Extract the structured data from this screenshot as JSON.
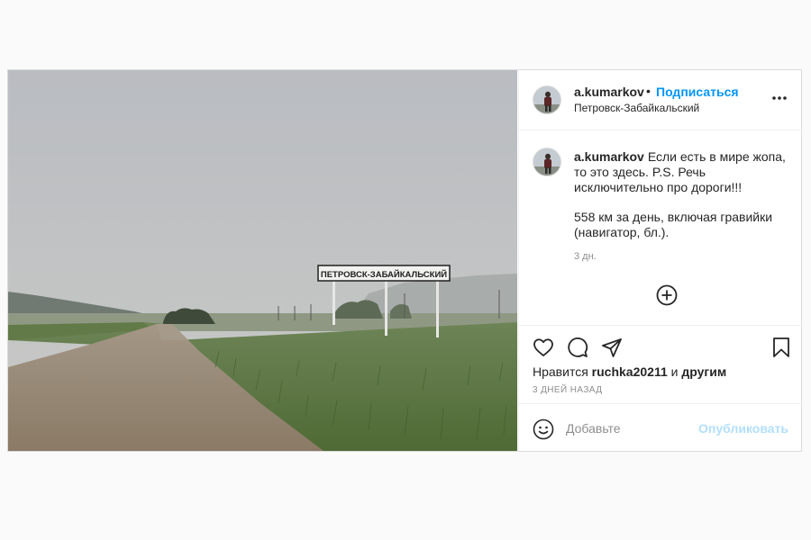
{
  "post": {
    "username": "a.kumarkov",
    "separator": "•",
    "follow_label": "Подписаться",
    "location": "Петровск-Забайкальский",
    "caption_line1": "Если есть в мире жопа, то это здесь. P.S. Речь исключительно про дороги!!!",
    "caption_line2": "558 км за день, включая гравийки (навигатор, бл.).",
    "time_ago": "3 дн.",
    "likes_prefix": "Нравится",
    "likes_user": "ruchka20211",
    "likes_and": "и",
    "likes_others": "другим",
    "date": "3 дней назад",
    "comment_placeholder": "Добавьте",
    "publish_label": "Опубликовать",
    "road_sign": "ПЕТРОВСК-ЗАБАЙКАЛЬСКИЙ"
  },
  "icons": {
    "more": "more-horizontal-icon",
    "plus": "plus-circle-icon",
    "like": "heart-icon",
    "comment": "comment-icon",
    "share": "share-icon",
    "save": "bookmark-icon",
    "emoji": "emoji-icon"
  },
  "colors": {
    "accent": "#0095f6",
    "publish_disabled": "#b2dffc",
    "text": "#262626",
    "muted": "#8e8e8e"
  }
}
